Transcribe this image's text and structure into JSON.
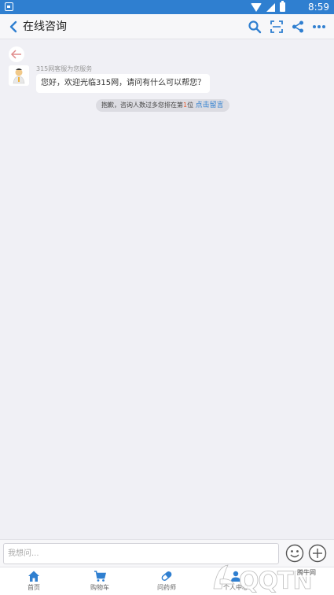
{
  "status_bar": {
    "time": "8:59",
    "icons": [
      "notification-icon",
      "wifi-icon",
      "signal-icon",
      "battery-icon"
    ]
  },
  "header": {
    "title": "在线咨询",
    "actions": [
      "search-icon",
      "scan-icon",
      "share-icon",
      "more-icon"
    ]
  },
  "chat": {
    "sender_caption": "315网客服为您服务",
    "messages": [
      {
        "from": "agent",
        "text": "您好，欢迎光临315网，请问有什么可以帮您？"
      }
    ],
    "queue_notice": {
      "prefix": "抱歉，咨询人数过多您排在第",
      "position": "1",
      "suffix": "位",
      "link_label": "点击留言"
    }
  },
  "input_bar": {
    "placeholder": "我想问...",
    "value": ""
  },
  "bottom_nav": {
    "items": [
      {
        "label": "首页",
        "icon": "home-icon"
      },
      {
        "label": "购物车",
        "icon": "cart-icon"
      },
      {
        "label": "问药师",
        "icon": "pill-icon"
      },
      {
        "label": "个人中心",
        "icon": "user-icon"
      }
    ]
  },
  "watermark": {
    "text": "QQTN",
    "caption": "腾牛网"
  },
  "colors": {
    "brand": "#2f7fd0",
    "accent_number": "#e65a2c",
    "background": "#f0f0f5"
  }
}
